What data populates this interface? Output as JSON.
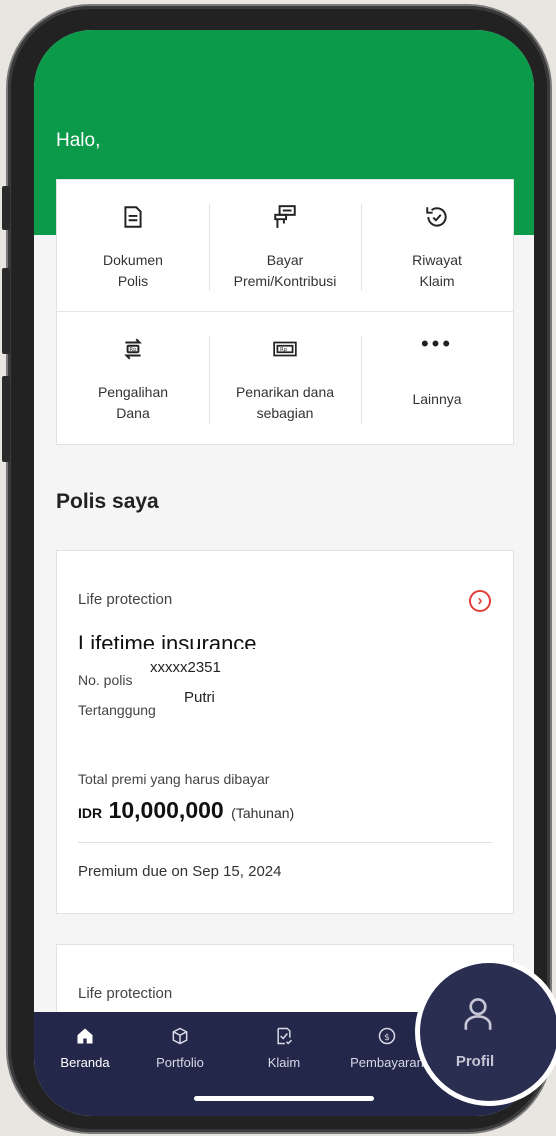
{
  "header": {
    "greeting": "Halo,"
  },
  "quick_actions": [
    {
      "label": "Dokumen\nPolis",
      "icon": "document-icon"
    },
    {
      "label": "Bayar\nPremi/Kontribusi",
      "icon": "payment-form-icon"
    },
    {
      "label": "Riwayat\nKlaim",
      "icon": "history-check-icon"
    },
    {
      "label": "Pengalihan\nDana",
      "icon": "fund-switch-icon"
    },
    {
      "label": "Penarikan dana\nsebagian",
      "icon": "withdraw-icon"
    },
    {
      "label": "Lainnya",
      "icon": "more-dots-icon"
    }
  ],
  "section": {
    "title": "Polis saya"
  },
  "policy": {
    "category": "Life protection",
    "name": "Lifetime insurance",
    "policy_no_label": "No. polis",
    "policy_no": "xxxxx2351",
    "insured_label": "Tertanggung",
    "insured": "Putri",
    "premium_label": "Total premi yang harus dibayar",
    "currency": "IDR",
    "amount": "10,000,000",
    "period": "(Tahunan)",
    "due": "Premium due on Sep 15, 2024"
  },
  "policy2": {
    "category": "Life protection"
  },
  "tabbar": {
    "items": [
      {
        "label": "Beranda",
        "icon": "home-icon",
        "active": true
      },
      {
        "label": "Portfolio",
        "icon": "box-icon"
      },
      {
        "label": "Klaim",
        "icon": "claim-icon"
      },
      {
        "label": "Pembayaran",
        "icon": "payment-icon"
      },
      {
        "label": "Profil",
        "icon": "profile-icon"
      }
    ]
  },
  "colors": {
    "header_green": "#0b9a4a",
    "tabbar_navy": "#23284a",
    "accent_red": "#e0403a"
  }
}
